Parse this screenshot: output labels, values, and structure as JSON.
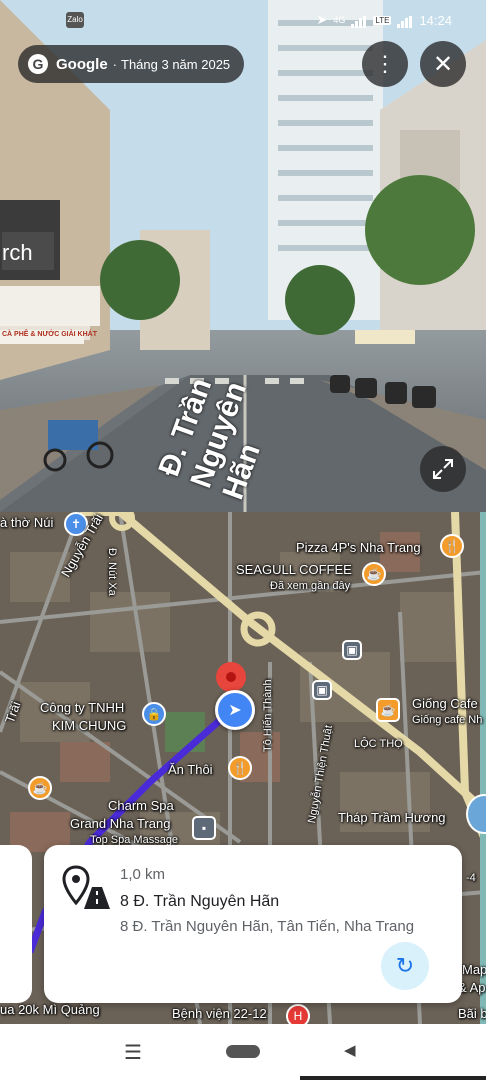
{
  "status_bar": {
    "zalo_label": "Zalo",
    "network": "4G",
    "lte": "LTE",
    "time": "14:24"
  },
  "street_view": {
    "brand": "Google",
    "separator": "·",
    "date": "Tháng 3 năm 2025",
    "street_label": "Đ. Trần Nguyên Hãn",
    "shop_sign": "CÀ PHÊ & NƯỚC GIẢI KHÁT",
    "sign_partial": "rch",
    "icons": {
      "more": "more-vert-icon",
      "close": "close-icon",
      "expand": "expand-icon"
    }
  },
  "map": {
    "labels": {
      "tho_nui": "à thờ Núi",
      "nguyen_trai": "Nguyễn Trãi",
      "dnut_xa": "Đ. Nút Xa",
      "trai": "Trãi",
      "pizza": "Pizza 4P's Nha Trang",
      "seagull": "SEAGULL COFFEE",
      "seagull_sub": "Đã xem gần đây",
      "cong_ty_1": "Công ty TNHH",
      "cong_ty_2": "KIM CHUNG",
      "to_hien_thanh": "Tô Hiến Thành",
      "nguyen_thien_thuat": "Nguyễn Thiện Thuật",
      "giong_cafe": "Giống Cafe",
      "giong_cafe_sub": "Giống cafe Nh",
      "loc_tho": "LỘC THỌ",
      "an_thoi": "Ăn Thôi",
      "charm_spa": "Charm Spa",
      "grand_nha_trang": "Grand Nha Trang",
      "top_spa": "Top Spa Massage",
      "thap_tram_huong": "Tháp Trầm Hương",
      "mi_quang": "ua 20k Mì Quảng",
      "benh_vien": "Bệnh viện 22-12",
      "map_right": "Map",
      "ap_right": "& Ap",
      "bai_b": "Bãi b",
      "four": "-4"
    },
    "accent_route": "#4a2bd8",
    "road_color": "#e6d9a8"
  },
  "card": {
    "distance": "1,0 km",
    "title": "8 Đ. Trần Nguyên Hãn",
    "address": "8 Đ. Trần Nguyên Hãn, Tân Tiến, Nha Trang",
    "icon": "place-road-icon",
    "refresh_icon": "refresh-icon"
  },
  "navbar": {
    "menu": "☰",
    "back": "◀"
  }
}
